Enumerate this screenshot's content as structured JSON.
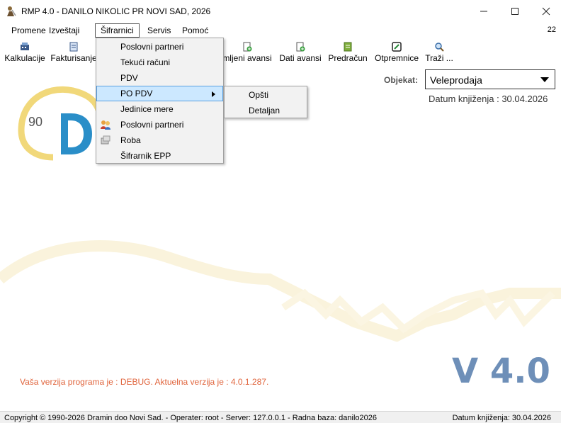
{
  "window": {
    "title": "RMP 4.0 - DANILO NIKOLIC PR NOVI SAD, 2026",
    "minimize": "—",
    "maximize": "☐",
    "close": "✕"
  },
  "menubar": {
    "items": [
      "Promene",
      "Izveštaji",
      "Šifrarnici",
      "Servis",
      "Pomoć"
    ],
    "active": "Šifrarnici",
    "right_text": "22"
  },
  "toolbar": {
    "items": [
      {
        "label": "Kalkulacije",
        "icon": "calculator-icon"
      },
      {
        "label": "Fakturisanje",
        "icon": "invoice-icon"
      },
      {
        "label": "mljeni avansi",
        "icon": "document-add-icon"
      },
      {
        "label": "Dati avansi",
        "icon": "document-add-icon"
      },
      {
        "label": "Predračun",
        "icon": "pro-forma-icon"
      },
      {
        "label": "Otpremnice",
        "icon": "delivery-note-icon"
      },
      {
        "label": "Traži ...",
        "icon": "search-icon"
      }
    ]
  },
  "main": {
    "objekat_label": "Objekat:",
    "objekat_value": "Veleprodaja",
    "datum_knjizenja": "Datum knjiženja : 30.04.2026",
    "logo_text": "90",
    "debug_text": "Vaša verzija programa je : DEBUG. Aktuelna verzija je : 4.0.1.287.",
    "version_text": "V 4.0"
  },
  "dropdown": {
    "items": [
      {
        "label": "Poslovni partneri",
        "icon": ""
      },
      {
        "label": "Tekući računi",
        "icon": ""
      },
      {
        "label": "PDV",
        "icon": ""
      },
      {
        "label": "PO PDV",
        "icon": "",
        "submenu": true,
        "highlighted": true
      },
      {
        "label": "Jedinice mere",
        "icon": ""
      },
      {
        "label": "Poslovni partneri",
        "icon": "partners-icon"
      },
      {
        "label": "Roba",
        "icon": "goods-icon"
      },
      {
        "label": "Šifrarnik EPP",
        "icon": ""
      }
    ]
  },
  "submenu": {
    "items": [
      "Opšti",
      "Detaljan"
    ]
  },
  "statusbar": {
    "left": "Copyright © 1990-2026 Dramin doo Novi Sad. - Operater: root - Server: 127.0.0.1 - Radna baza: danilo2026",
    "right": "Datum knjiženja: 30.04.2026"
  },
  "colors": {
    "accent_blue": "#6e8fb8",
    "debug_orange": "#e0643c",
    "highlight": "#cce8ff",
    "logo_yellow": "#f1d87a"
  }
}
